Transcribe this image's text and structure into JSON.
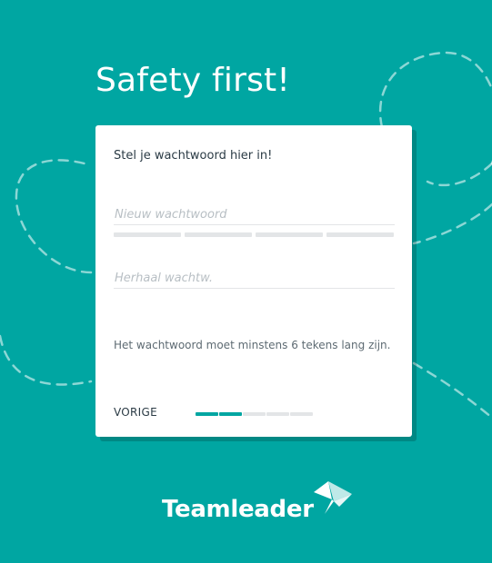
{
  "page": {
    "headline": "Safety first!"
  },
  "card": {
    "intro": "Stel je wachtwoord hier in!",
    "new_password": {
      "value": "",
      "placeholder": "Nieuw wachtwoord"
    },
    "repeat_password": {
      "value": "",
      "placeholder": "Herhaal wachtw."
    },
    "strength_meter": {
      "segments": 4,
      "filled": 0
    },
    "hint": "Het wachtwoord moet minstens 6 tekens lang zijn.",
    "back_label": "VORIGE",
    "progress": {
      "total_steps": 5,
      "completed_steps": 2
    }
  },
  "brand": {
    "name": "Teamleader",
    "logo_icon": "teamleader-logo-icon"
  },
  "colors": {
    "background": "#00A6A2",
    "accent": "#00A6A2",
    "card": "#FFFFFF",
    "text": "#2B3B45",
    "muted": "#5E6B73",
    "track": "#E3E5E7"
  }
}
